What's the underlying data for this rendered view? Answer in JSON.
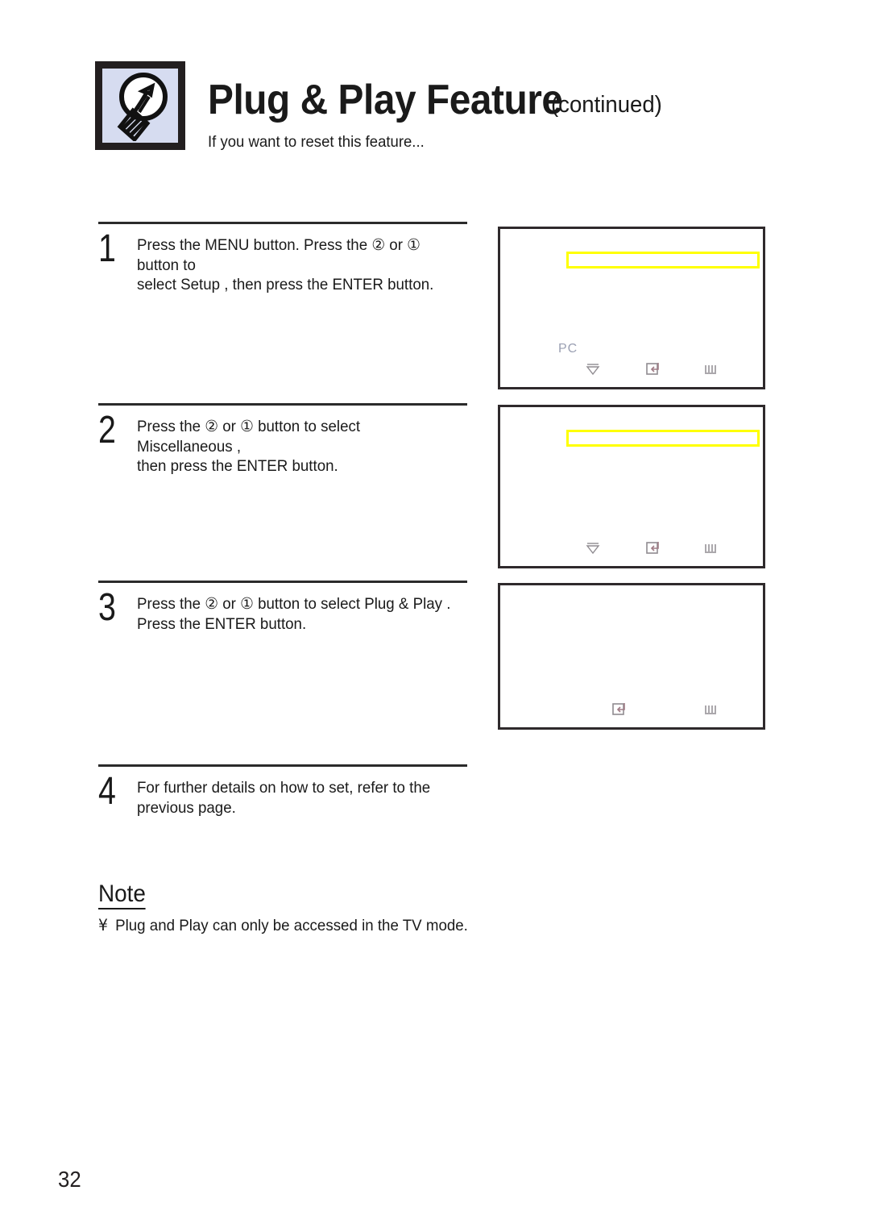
{
  "header": {
    "icon_name": "lightbulb-icon",
    "title": "Plug & Play Feature",
    "continued": "(continued)",
    "subtitle": "If you want to reset this feature..."
  },
  "steps": [
    {
      "number": "1",
      "text": "Press the MENU button. Press the ② or ① button to\nselect  Setup , then press the ENTER button."
    },
    {
      "number": "2",
      "text": "Press the ② or ① button to select  Miscellaneous ,\nthen press the ENTER button."
    },
    {
      "number": "3",
      "text": "Press the ② or ① button to select  Plug & Play .\nPress the ENTER button."
    },
    {
      "number": "4",
      "text": "For further details on how to set, refer to the\nprevious page."
    }
  ],
  "tv_panels": [
    {
      "name": "setup-menu-screen",
      "highlight_color": "#ffff00",
      "pc_label": "PC",
      "icons": [
        "move-down-icon",
        "enter-icon",
        "exit-icon"
      ]
    },
    {
      "name": "miscellaneous-menu-screen",
      "highlight_color": "#ffff00",
      "pc_label": "",
      "icons": [
        "move-down-icon",
        "enter-icon",
        "exit-icon"
      ]
    },
    {
      "name": "plug-and-play-screen",
      "highlight_color": "#ffff00",
      "pc_label": "",
      "icons": [
        "enter-icon",
        "exit-icon"
      ]
    }
  ],
  "note": {
    "title": "Note",
    "bullet": "¥",
    "body": "Plug and Play can only be accessed in the TV mode."
  },
  "footer": {
    "page_number": "32"
  },
  "colors": {
    "highlight": "#ffff00",
    "frame": "#231f20",
    "icon_bg": "#d6dcf0",
    "pc_text": "#9ba0b3"
  }
}
